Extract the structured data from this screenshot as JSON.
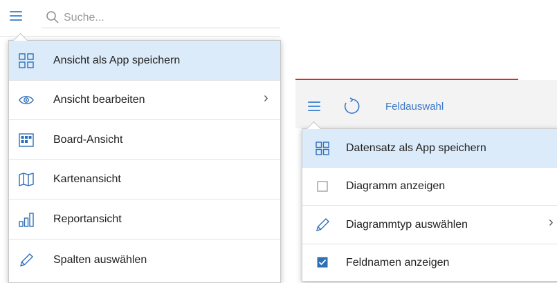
{
  "left": {
    "search_placeholder": "Suche...",
    "menu": [
      {
        "label": "Ansicht als App speichern",
        "icon": "app-grid-icon",
        "highlighted": true
      },
      {
        "label": "Ansicht bearbeiten",
        "icon": "eye-icon",
        "submenu": true
      },
      {
        "label": "Board-Ansicht",
        "icon": "board-icon"
      },
      {
        "label": "Kartenansicht",
        "icon": "map-icon"
      },
      {
        "label": "Reportansicht",
        "icon": "bar-chart-icon"
      },
      {
        "label": "Spalten auswählen",
        "icon": "pencil-icon"
      }
    ]
  },
  "right": {
    "toolbar_title": "Feldauswahl",
    "menu": [
      {
        "label": "Datensatz als App speichern",
        "icon": "app-grid-icon",
        "highlighted": true
      },
      {
        "label": "Diagramm anzeigen",
        "icon": "checkbox-unchecked-icon",
        "checked": false
      },
      {
        "label": "Diagrammtyp auswählen",
        "icon": "pencil-icon",
        "submenu": true
      },
      {
        "label": "Feldnamen anzeigen",
        "icon": "checkbox-checked-icon",
        "checked": true
      }
    ]
  },
  "colors": {
    "accent": "#4a8bd6",
    "highlight": "#dcebfa",
    "toolbar_bg": "#f3f3f3",
    "red_line": "#e0262d"
  }
}
